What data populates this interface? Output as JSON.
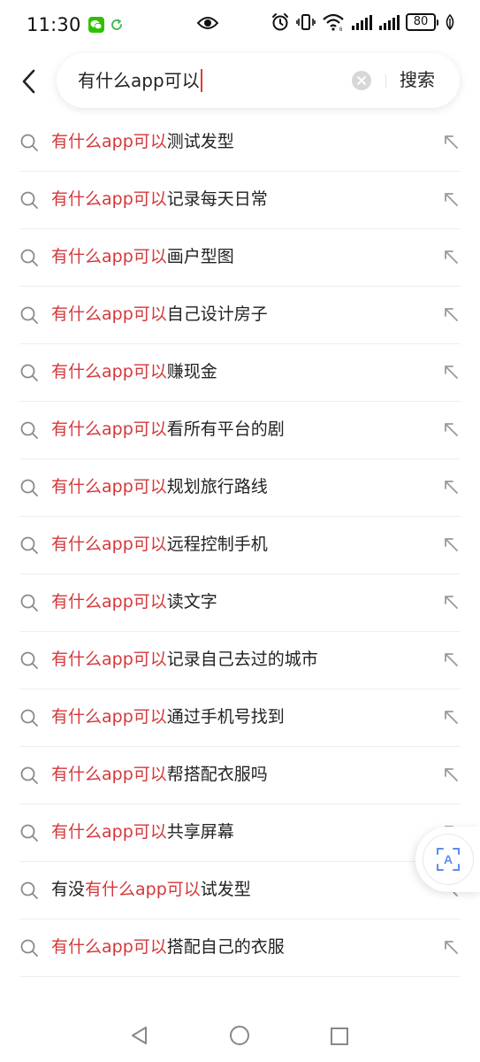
{
  "status_bar": {
    "time": "11:30",
    "battery": "80",
    "icons": [
      "wechat-icon",
      "sync-icon",
      "eye-icon",
      "alarm-icon",
      "vibrate-icon",
      "wifi-icon",
      "signal-icon",
      "signal-icon",
      "battery-icon",
      "leaf-icon"
    ]
  },
  "search": {
    "query": "有什么app可以",
    "search_button_label": "搜索",
    "caret_color": "#e53935"
  },
  "highlight_color": "#d4383b",
  "suggestions": [
    {
      "prefix": "",
      "highlight": "有什么app可以",
      "suffix": "测试发型"
    },
    {
      "prefix": "",
      "highlight": "有什么app可以",
      "suffix": "记录每天日常"
    },
    {
      "prefix": "",
      "highlight": "有什么app可以",
      "suffix": "画户型图"
    },
    {
      "prefix": "",
      "highlight": "有什么app可以",
      "suffix": "自己设计房子"
    },
    {
      "prefix": "",
      "highlight": "有什么app可以",
      "suffix": "赚现金"
    },
    {
      "prefix": "",
      "highlight": "有什么app可以",
      "suffix": "看所有平台的剧"
    },
    {
      "prefix": "",
      "highlight": "有什么app可以",
      "suffix": "规划旅行路线"
    },
    {
      "prefix": "",
      "highlight": "有什么app可以",
      "suffix": "远程控制手机"
    },
    {
      "prefix": "",
      "highlight": "有什么app可以",
      "suffix": "读文字"
    },
    {
      "prefix": "",
      "highlight": "有什么app可以",
      "suffix": "记录自己去过的城市"
    },
    {
      "prefix": "",
      "highlight": "有什么app可以",
      "suffix": "通过手机号找到"
    },
    {
      "prefix": "",
      "highlight": "有什么app可以",
      "suffix": "帮搭配衣服吗"
    },
    {
      "prefix": "",
      "highlight": "有什么app可以",
      "suffix": "共享屏幕"
    },
    {
      "prefix": "有没",
      "highlight": "有什么app可以",
      "suffix": "试发型"
    },
    {
      "prefix": "",
      "highlight": "有什么app可以",
      "suffix": "搭配自己的衣服"
    }
  ],
  "float_button": {
    "icon": "translate-icon",
    "glyph": "A"
  },
  "nav": {
    "icons": [
      "nav-back-icon",
      "nav-home-icon",
      "nav-recent-icon"
    ]
  }
}
